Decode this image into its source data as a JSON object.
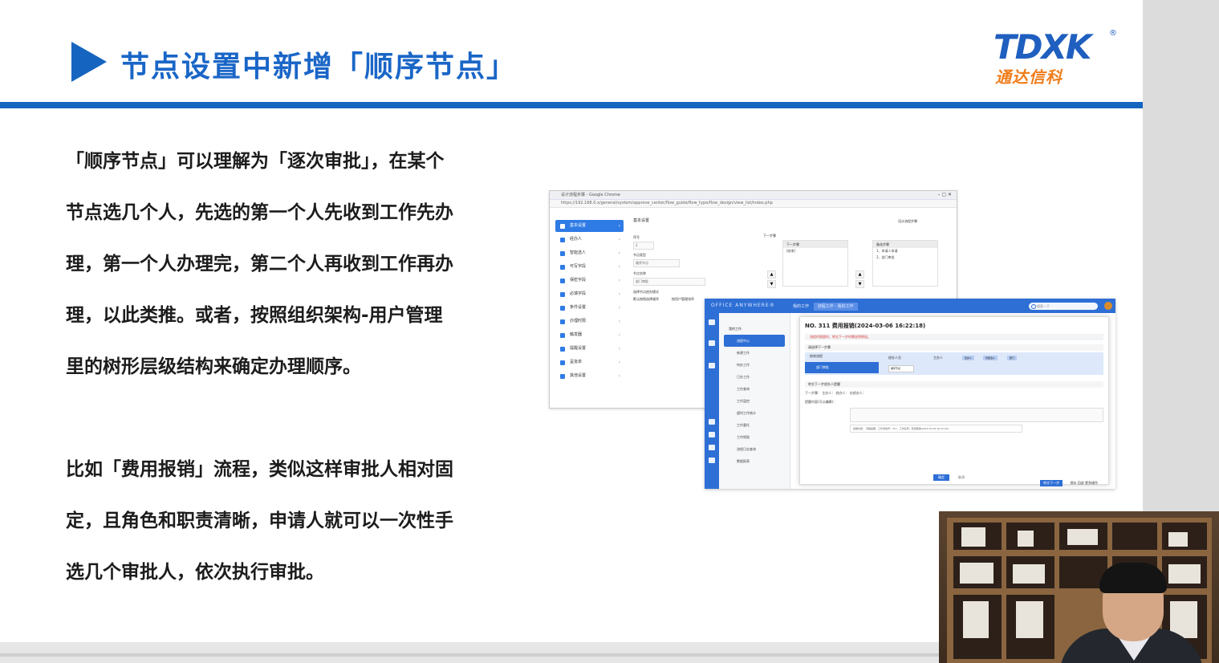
{
  "slide": {
    "title": "节点设置中新增「顺序节点」",
    "logo": {
      "mark": "TDXK",
      "reg": "®",
      "cn": "通达信科"
    },
    "paragraph1": [
      "「顺序节点」可以理解为「逐次审批」，在某个",
      "节点选几个人，先选的第一个人先收到工作先办",
      "理，第一个人办理完，第二个人再收到工作再办",
      "理，以此类推。或者，按照组织架构-用户管理",
      "里的树形层级结构来确定办理顺序。"
    ],
    "paragraph2": [
      "比如「费用报销」流程，类似这样审批人相对固",
      "定，且角色和职责清晰，申请人就可以一次性手",
      "选几个审批人，依次执行审批。"
    ]
  },
  "screenshot1": {
    "window_title": "设计流程步骤 - Google Chrome",
    "window_controls": "–  ▢  ✕",
    "url": "https://192.168.0.x/general/system/approve_center/flow_guide/flow_type/flow_design/view_list/index.php",
    "sidebar_items": [
      "基本设置",
      "经办人",
      "智能选人",
      "可写字段",
      "保密字段",
      "必填字段",
      "条件设置",
      "办理时限",
      "触发器",
      "提醒设置",
      "呈批单",
      "其他设置"
    ],
    "form_header": "基本设置",
    "form_header_right": "设计流程步骤",
    "labels": {
      "step_no": "序号",
      "step_type": "节点类型",
      "step_name": "节点名称",
      "next": "下一步骤",
      "options": "选择节点经办模式"
    },
    "values": {
      "step_no": "2",
      "step_type": "顺序节点",
      "step_name": "部门审批"
    },
    "list_a_header": "下一步骤",
    "list_a_item": "[结束]",
    "list_b_header": "备选步骤",
    "list_b_items": [
      "1、申请人申请",
      "2、部门审批"
    ],
    "radio_a": "默认按照选择顺序",
    "radio_b": "按用户管理排序"
  },
  "screenshot2": {
    "brand": "OFFICE ANYWHERE®",
    "tabs": [
      "我的工作",
      "流程工作 - 我的工作"
    ],
    "search_placeholder": "搜索一下",
    "nav_items": [
      "我的工作",
      "流程中心",
      "新建工作",
      "待办工作",
      "已办工作",
      "工作查询",
      "工作监控",
      "超时工作统计",
      "工作委托",
      "工作销毁",
      "流程日志查询",
      "数据报表"
    ],
    "modal_title": "NO. 311 费用报销(2024-03-06 16:22:18)",
    "warning": "流程时限超时，转交下一步时需说明原因。",
    "section_next": "请选择下一步骤",
    "option_continue": "结束流程",
    "selected_step": "部门审批",
    "handler_label": "经办人员",
    "choose_label": "主办人",
    "chips": [
      "经办人",
      "智能选人",
      "部门"
    ],
    "small_field": "顺序节点",
    "section_notify": "转交下一步经办人提醒",
    "row1": "下一步骤：  主办人：  经办人：  仅经办人：",
    "row2": "提醒内容(可以编辑)：",
    "row3": "提醒内容：  流程提醒：工作流编号：311，工作名称：费用报销(2024-03-06 16:22:18)",
    "ok": "确定",
    "cancel": "取消",
    "footer_btn": "转交下一步",
    "footer_links": "保存   回退   更多操作"
  }
}
